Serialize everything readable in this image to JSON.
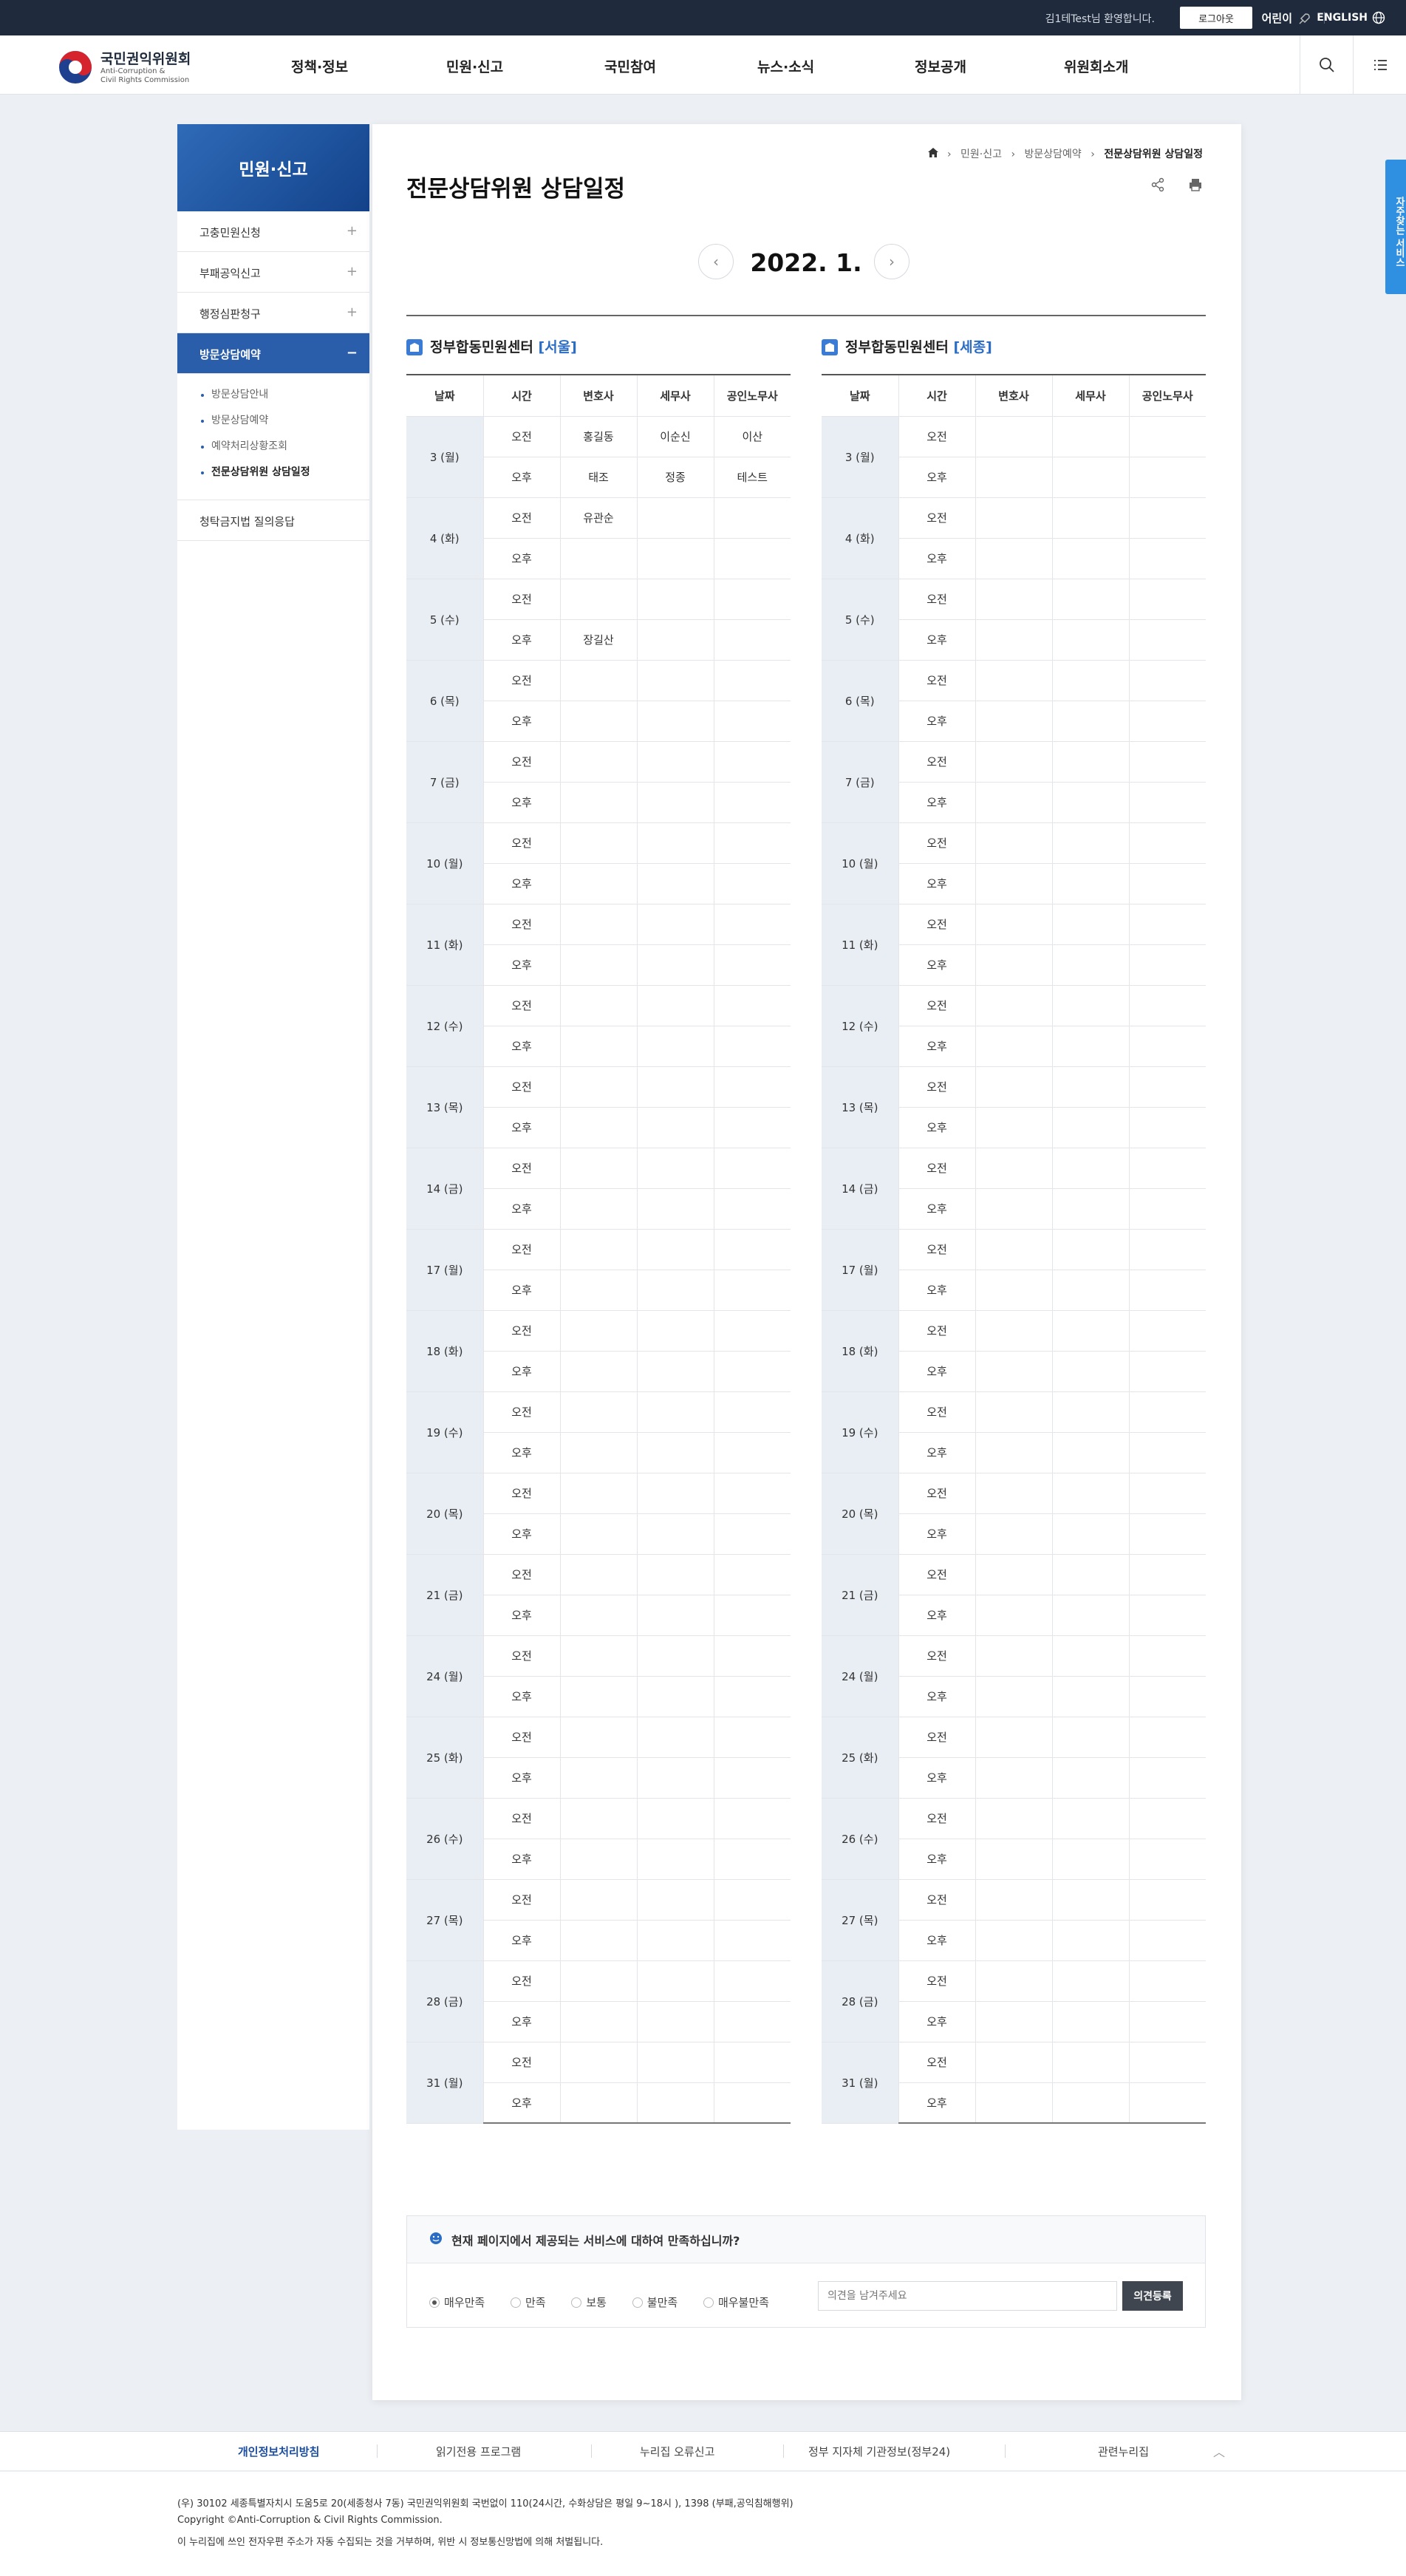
{
  "topbar": {
    "greeting": "김1테Test님 환영합니다.",
    "logout": "로그아웃",
    "kids": "어린이",
    "english": "ENGLISH"
  },
  "logo": {
    "name": "국민권익위원회",
    "eng1": "Anti-Corruption &",
    "eng2": "Civil Rights Commission"
  },
  "menu": [
    "정책·정보",
    "민원·신고",
    "국민참여",
    "뉴스·소식",
    "정보공개",
    "위원회소개"
  ],
  "lnb": {
    "title": "민원·신고",
    "items": [
      "고충민원신청",
      "부패공익신고",
      "행정심판청구",
      "방문상담예약",
      "청탁금지법 질의응답"
    ],
    "sub": [
      "방문상담안내",
      "방문상담예약",
      "예약처리상황조회",
      "전문상담위원 상담일정"
    ]
  },
  "breadcrumb": [
    "민원·신고",
    "방문상담예약",
    "전문상담위원 상담일정"
  ],
  "page_title": "전문상담위원 상담일정",
  "month_label": "2022. 1.",
  "quick_label": "자주찾는 서비스",
  "centers": [
    {
      "title": "정부합동민원센터",
      "tag": "[서울]"
    },
    {
      "title": "정부합동민원센터",
      "tag": "[세종]"
    }
  ],
  "table_headers": [
    "날짜",
    "시간",
    "변호사",
    "세무사",
    "공인노무사"
  ],
  "periods": [
    "오전",
    "오후"
  ],
  "dates": [
    "3 (월)",
    "4 (화)",
    "5 (수)",
    "6 (목)",
    "7 (금)",
    "10 (월)",
    "11 (화)",
    "12 (수)",
    "13 (목)",
    "14 (금)",
    "17 (월)",
    "18 (화)",
    "19 (수)",
    "20 (목)",
    "21 (금)",
    "24 (월)",
    "25 (화)",
    "26 (수)",
    "27 (목)",
    "28 (금)",
    "31 (월)"
  ],
  "seoul_entries": [
    [
      "홍길동",
      "이순신",
      "이산"
    ],
    [
      "태조",
      "정종",
      "테스트"
    ],
    [
      "유관순",
      "",
      ""
    ],
    [
      "",
      "",
      ""
    ],
    [
      "",
      "",
      ""
    ],
    [
      "장길산",
      "",
      ""
    ]
  ],
  "survey": {
    "question": "현재 페이지에서 제공되는 서비스에 대하여 만족하십니까?",
    "options": [
      "매우만족",
      "만족",
      "보통",
      "불만족",
      "매우불만족"
    ],
    "placeholder": "의견을 남겨주세요",
    "submit": "의견등록"
  },
  "footer_links": [
    "개인정보처리방침",
    "읽기전용 프로그램",
    "누리집 오류신고",
    "정부 지자체 기관정보(정부24)",
    "관련누리집"
  ],
  "footer_lines": [
    "(우) 30102 세종특별자치시 도움5로 20(세종청사 7동) 국민권익위원회    국번없이 110(24시간, 수화상담은 평일 9~18시 ), 1398 (부패,공익침해행위)",
    "Copyright ©Anti-Corruption & Civil Rights Commission.",
    "이 누리집에 쓰인 전자우편 주소가 자동 수집되는 것을 거부하며, 위반 시 정보통신망법에 의해 처벌됩니다."
  ]
}
